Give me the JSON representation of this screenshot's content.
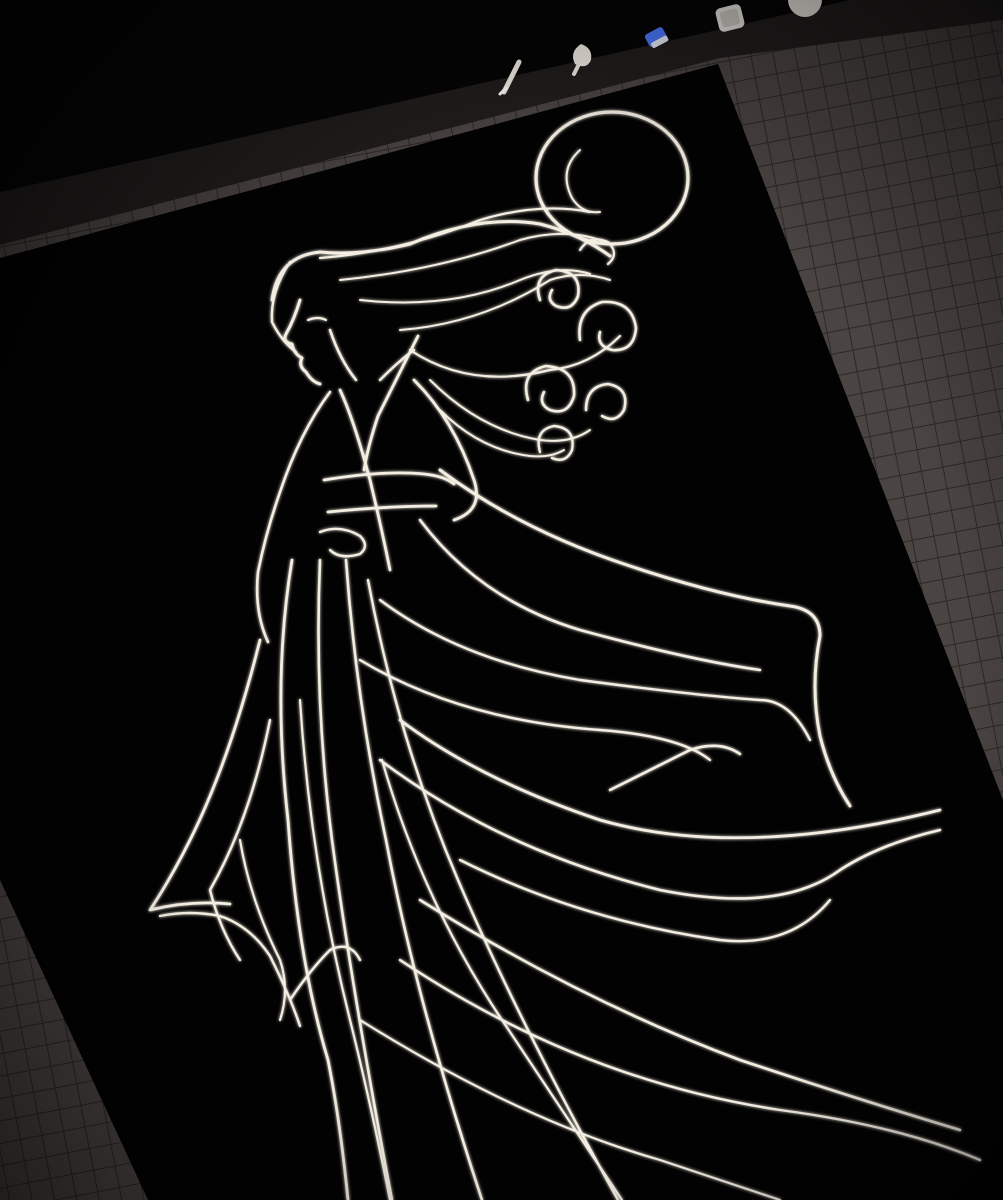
{
  "scene": {
    "description_type": "photo of a tablet drawing app",
    "colors": {
      "ambient": "#050505",
      "grid_background": "#4a4442",
      "grid_lines": "#2c2827",
      "canvas": "#020202",
      "toolbar": "#201d1c",
      "line_art": "#f4eee2",
      "eraser_accent": "#4b78ff"
    },
    "toolbar": {
      "tools": [
        {
          "name": "brush",
          "icon": "brush-icon"
        },
        {
          "name": "smudge",
          "icon": "smudge-icon"
        },
        {
          "name": "eraser",
          "icon": "eraser-icon"
        },
        {
          "name": "layers",
          "icon": "layers-icon"
        },
        {
          "name": "color",
          "icon": "color-swatch-icon"
        }
      ]
    }
  }
}
